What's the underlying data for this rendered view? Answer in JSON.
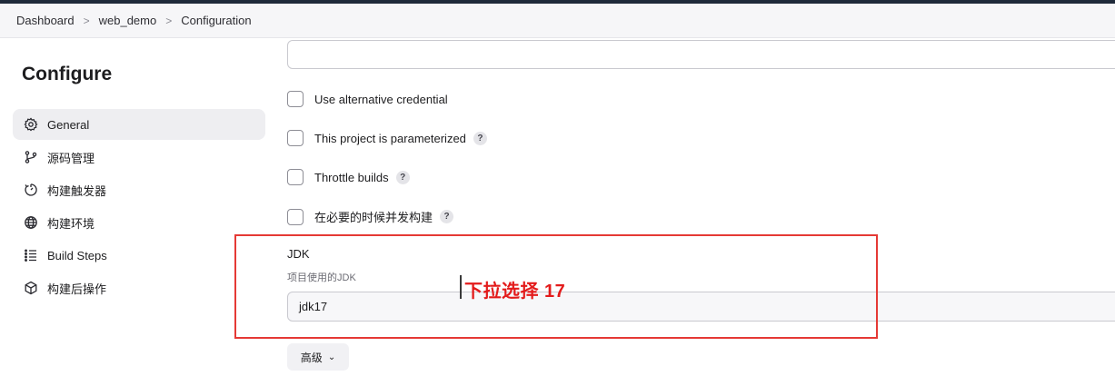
{
  "breadcrumb": {
    "items": [
      "Dashboard",
      "web_demo",
      "Configuration"
    ],
    "separator": ">"
  },
  "sidebar": {
    "title": "Configure",
    "items": [
      {
        "label": "General",
        "icon": "gear-icon",
        "active": true
      },
      {
        "label": "源码管理",
        "icon": "branch-icon",
        "active": false
      },
      {
        "label": "构建触发器",
        "icon": "timer-icon",
        "active": false
      },
      {
        "label": "构建环境",
        "icon": "globe-icon",
        "active": false
      },
      {
        "label": "Build Steps",
        "icon": "list-icon",
        "active": false
      },
      {
        "label": "构建后操作",
        "icon": "cube-icon",
        "active": false
      }
    ]
  },
  "main": {
    "top_field_value": "",
    "options": [
      {
        "label": "Use alternative credential",
        "help": false
      },
      {
        "label": "This project is parameterized",
        "help": true
      },
      {
        "label": "Throttle builds",
        "help": true
      },
      {
        "label": "在必要的时候并发构建",
        "help": true
      }
    ],
    "help_glyph": "?",
    "jdk": {
      "label": "JDK",
      "description": "项目使用的JDK",
      "selected": "jdk17"
    },
    "advanced_label": "高级",
    "advanced_chevron": "⌄"
  },
  "annotation": {
    "text": "下拉选择 17",
    "color": "#e31b1b"
  }
}
